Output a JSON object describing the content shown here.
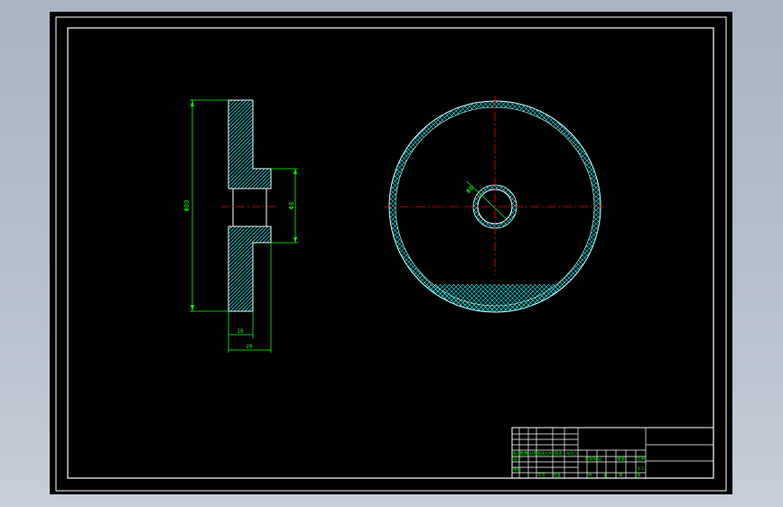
{
  "drawing": {
    "dimensions": {
      "outer_diameter": "Φ80",
      "bore_diameter": "Φ8",
      "hub_diameter": "Φ8",
      "rim_width": "10",
      "total_width": "20"
    },
    "title_block": {
      "row_labels": [
        "标记",
        "处数",
        "分区",
        "更改文件号",
        "签名",
        "年月日"
      ],
      "col_labels": [
        "阶段标记",
        "重量",
        "比例"
      ],
      "scale": "1:1",
      "sheet_labels": [
        "共",
        "张",
        "第",
        "张"
      ],
      "designer_label": "设计",
      "review_label": "审核",
      "process_label": "工艺",
      "approve_label": "批准"
    }
  },
  "colors": {
    "background": "#000000",
    "frame": "#ffffff",
    "outline": "#ffffff",
    "dimension": "#00ff00",
    "hatch": "#00ffff",
    "centerline": "#ff0000"
  }
}
